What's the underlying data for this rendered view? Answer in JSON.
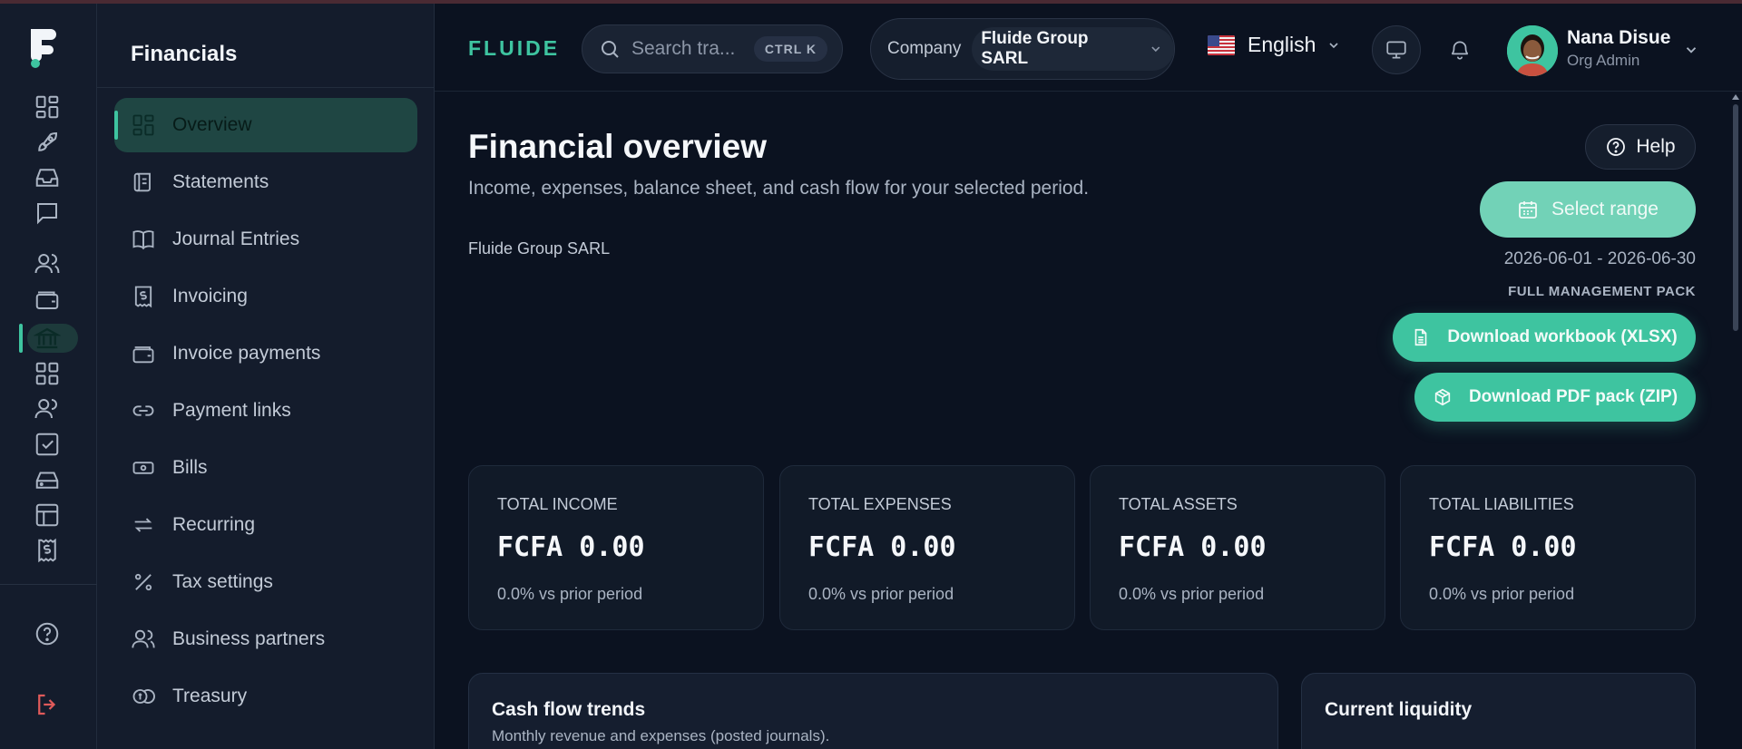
{
  "sidebar": {
    "title": "Financials",
    "items": [
      {
        "label": "Overview",
        "icon": "grid-icon"
      },
      {
        "label": "Statements",
        "icon": "scroll-icon"
      },
      {
        "label": "Journal Entries",
        "icon": "book-icon"
      },
      {
        "label": "Invoicing",
        "icon": "dollar-receipt-icon"
      },
      {
        "label": "Invoice payments",
        "icon": "wallet-icon"
      },
      {
        "label": "Payment links",
        "icon": "link-icon"
      },
      {
        "label": "Bills",
        "icon": "banknote-icon"
      },
      {
        "label": "Recurring",
        "icon": "repeat-icon"
      },
      {
        "label": "Tax settings",
        "icon": "percent-icon"
      },
      {
        "label": "Business partners",
        "icon": "users-icon"
      },
      {
        "label": "Treasury",
        "icon": "coins-icon"
      }
    ]
  },
  "header": {
    "brand": "FLUIDE",
    "search_placeholder": "Search tra...",
    "search_shortcut": "CTRL K",
    "company_label": "Company",
    "company_value": "Fluide Group SARL",
    "language": "English",
    "user_name": "Nana Disue",
    "user_role": "Org Admin"
  },
  "page": {
    "title": "Financial overview",
    "subtitle": "Income, expenses, balance sheet, and cash flow for your selected period.",
    "company": "Fluide Group SARL",
    "help_label": "Help",
    "range_button": "Select range",
    "range_dates": "2026-06-01 - 2026-06-30",
    "pack_label": "FULL MANAGEMENT PACK",
    "download_xlsx": "Download workbook (XLSX)",
    "download_zip": "Download PDF pack (ZIP)"
  },
  "kpis": [
    {
      "label": "TOTAL INCOME",
      "value": "FCFA 0.00",
      "delta": "0.0% vs prior period"
    },
    {
      "label": "TOTAL EXPENSES",
      "value": "FCFA 0.00",
      "delta": "0.0% vs prior period"
    },
    {
      "label": "TOTAL ASSETS",
      "value": "FCFA 0.00",
      "delta": "0.0% vs prior period"
    },
    {
      "label": "TOTAL LIABILITIES",
      "value": "FCFA 0.00",
      "delta": "0.0% vs prior period"
    }
  ],
  "panels": {
    "cashflow_title": "Cash flow trends",
    "cashflow_sub": "Monthly revenue and expenses (posted journals).",
    "liquidity_title": "Current liquidity"
  },
  "colors": {
    "accent": "#3ec4a0",
    "background": "#0b1220",
    "sidebar": "#141c2c"
  }
}
